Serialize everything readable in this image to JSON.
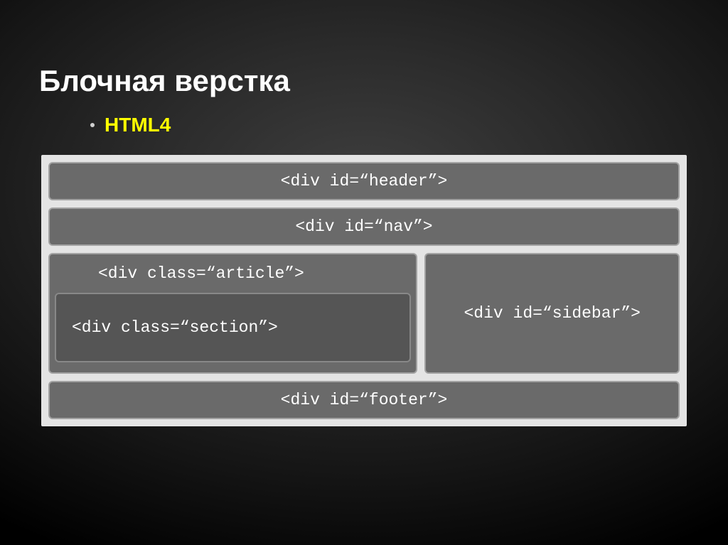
{
  "slide": {
    "title": "Блочная верстка",
    "bullet": "HTML4"
  },
  "diagram": {
    "header": "<div id=“header”>",
    "nav": "<div id=“nav”>",
    "article": "<div class=“article”>",
    "section": "<div class=“section”>",
    "sidebar": "<div id=“sidebar”>",
    "footer": "<div id=“footer”>"
  }
}
